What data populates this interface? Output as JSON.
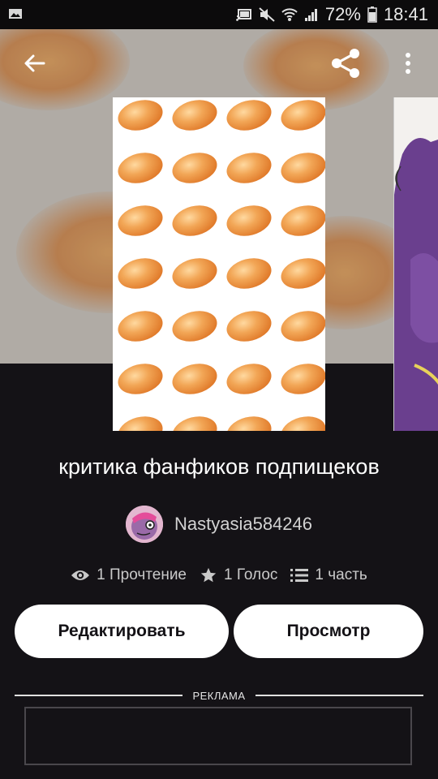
{
  "status_bar": {
    "battery": "72%",
    "time": "18:41",
    "icons": [
      "image-icon",
      "cast-icon",
      "mute-icon",
      "wifi-icon",
      "signal-icon",
      "battery-icon"
    ]
  },
  "toolbar": {
    "icons": [
      "back-arrow-icon",
      "share-icon",
      "more-vert-icon"
    ]
  },
  "story": {
    "title": "критика фанфиков подпищеков",
    "author": "Nastyasia584246",
    "stats": {
      "reads": "1 Прочтение",
      "votes": "1 Голос",
      "parts": "1 часть"
    }
  },
  "actions": {
    "edit_label": "Редактировать",
    "preview_label": "Просмотр"
  },
  "ad": {
    "label": "РЕКЛАМА"
  },
  "colors": {
    "background": "#141216",
    "button_bg": "#ffffff",
    "button_text": "#141216",
    "muted_text": "#c9c9c9"
  }
}
